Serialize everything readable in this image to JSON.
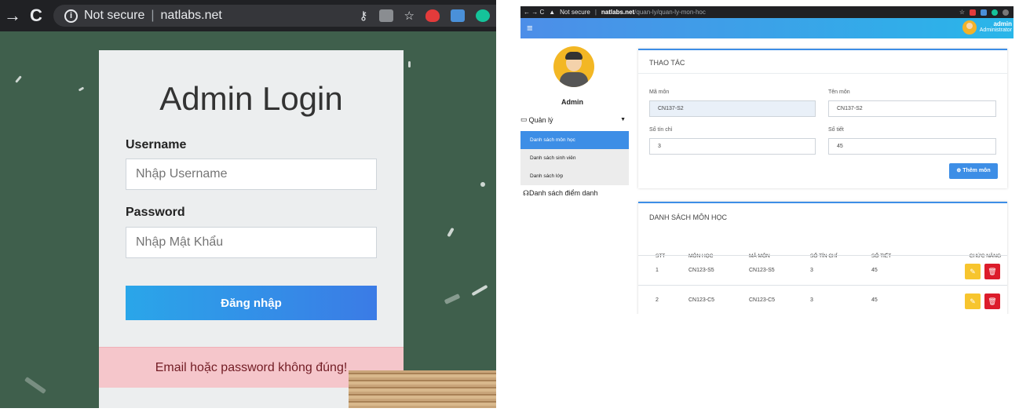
{
  "left_browser": {
    "nav_back": "→",
    "nav_reload": "C",
    "security_icon": "info-icon",
    "security_text": "Not secure",
    "url": "natlabs.net"
  },
  "login": {
    "title": "Admin Login",
    "username_label": "Username",
    "username_placeholder": "Nhập Username",
    "password_label": "Password",
    "password_placeholder": "Nhập Mật Khẩu",
    "submit_label": "Đăng nhập",
    "error_message": "Email hoặc password không đúng!"
  },
  "right_browser": {
    "nav": "← → C",
    "security_text": "Not secure",
    "url_host": "natlabs.net",
    "url_path": "/quan-ly/quan-ly-mon-hoc"
  },
  "app_header": {
    "menu_icon": "≡",
    "user_name": "admin",
    "user_role": "Administrator"
  },
  "sidebar": {
    "profile_name": "Admin",
    "group_label": "Quản lý",
    "items": [
      {
        "label": "Danh sách môn học",
        "active": true
      },
      {
        "label": "Danh sách sinh viên",
        "active": false
      },
      {
        "label": "Danh sách lớp",
        "active": false
      }
    ],
    "attendance_label": "Danh sách điểm danh"
  },
  "form": {
    "header": "THAO TÁC",
    "ma_mon_label": "Mã môn",
    "ma_mon_value": "CN137-S2",
    "ten_mon_label": "Tên môn",
    "ten_mon_value": "CN137-S2",
    "so_tin_chi_label": "Số tín chỉ",
    "so_tin_chi_value": "3",
    "so_tiet_label": "Số tiết",
    "so_tiet_value": "45",
    "add_button": "Thêm môn"
  },
  "list": {
    "header": "DANH SÁCH MÔN HỌC",
    "columns": [
      "STT",
      "MÔN HỌC",
      "MÃ MÔN",
      "SỐ TÍN CHỈ",
      "SỐ TIẾT",
      "CHỨC NĂNG"
    ],
    "rows": [
      {
        "stt": "1",
        "mon_hoc": "CN123-S5",
        "ma_mon": "CN123-S5",
        "so_tin_chi": "3",
        "so_tiet": "45"
      },
      {
        "stt": "2",
        "mon_hoc": "CN123-C5",
        "ma_mon": "CN123-C5",
        "so_tin_chi": "3",
        "so_tiet": "45"
      }
    ]
  },
  "colors": {
    "accent": "#3d8ee6",
    "edit": "#f7c52e",
    "delete": "#dc1c2b",
    "chalkboard": "#3f5f4c",
    "alert_bg": "#f5c6cb"
  }
}
